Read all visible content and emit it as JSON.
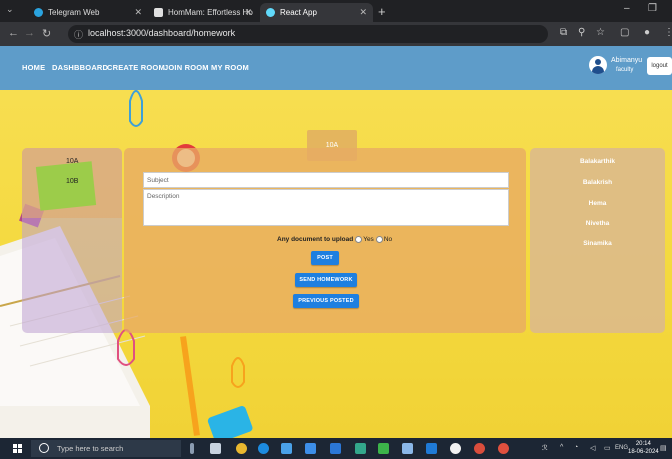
{
  "browser": {
    "tabs": [
      {
        "title": "Telegram Web",
        "color": "#2aa3df"
      },
      {
        "title": "HomMam: Effortless Homework",
        "color": "#e0e0e0"
      },
      {
        "title": "React App",
        "color": "#61dafb"
      }
    ],
    "url": "localhost:3000/dashboard/homework"
  },
  "navbar": {
    "links": [
      "HOME",
      "DASHBBOARD",
      "CREATE ROOM",
      "JOIN ROOM",
      "MY ROOM"
    ],
    "user_name": "Abimanyu",
    "user_role": "faculty",
    "logout_label": "logout",
    "bar_color": "#5e9cc9"
  },
  "main": {
    "selected_class": "10A",
    "classes": [
      "10A",
      "10B"
    ],
    "subject_placeholder": "Subject",
    "description_placeholder": "Description",
    "upload_question": "Any document to upload",
    "yes_label": "Yes",
    "no_label": "No",
    "post_label": "POST",
    "send_label": "SEND HOMEWORK",
    "previous_label": "PREVIOUS POSTED",
    "button_color": "#1e7fe0"
  },
  "students": [
    "Balakarthik",
    "Balakrish",
    "Hema",
    "Nivetha",
    "Sinamika"
  ],
  "taskbar": {
    "search_placeholder": "Type here to search",
    "lang": "ENG",
    "time": "20:14",
    "date": "18-06-2024"
  }
}
